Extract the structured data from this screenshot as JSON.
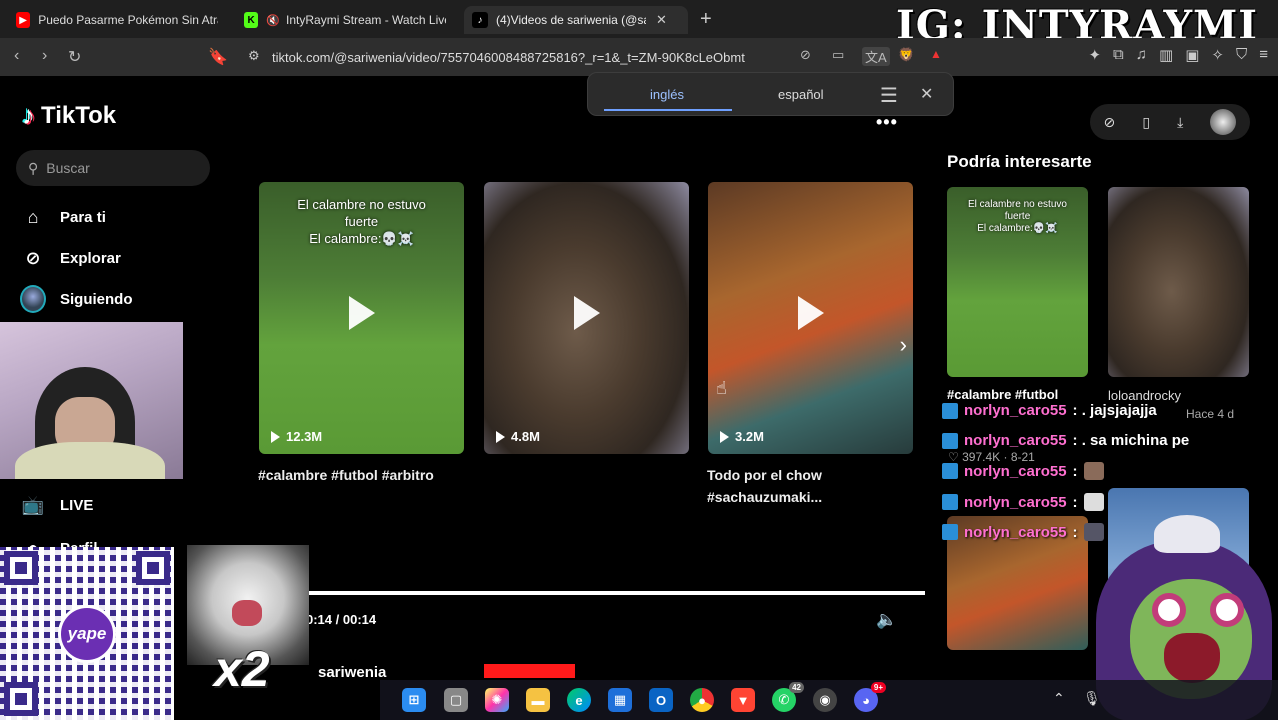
{
  "browser": {
    "tabs": [
      {
        "title": "Puedo Pasarme Pokémon Sin Atrapar",
        "icon": "youtube-icon"
      },
      {
        "title": "IntyRaymi Stream - Watch Live or",
        "icon": "kick-icon"
      },
      {
        "title": "(4)Videos de sariwenia (@sariwe",
        "icon": "tiktok-icon"
      }
    ],
    "url": "tiktok.com/@sariwenia/video/7557046008488725816?_r=1&_t=ZM-90K8cLeObmt",
    "overlay_text": "IG: INTYRAYMI"
  },
  "translate_popup": {
    "lang_from": "inglés",
    "lang_to": "español"
  },
  "tiktok": {
    "logo": "TikTok",
    "search_placeholder": "Buscar",
    "nav": {
      "for_you": "Para ti",
      "explore": "Explorar",
      "following": "Siguiendo",
      "live": "LIVE",
      "profile": "Perfil"
    },
    "videos": [
      {
        "caption_line1": "El calambre no estuvo",
        "caption_line2": "fuerte",
        "caption_line3": "El calambre:💀☠️",
        "views": "12.3M",
        "title": "#calambre #futbol #arbitro"
      },
      {
        "views": "4.8M"
      },
      {
        "views": "3.2M",
        "title_line1": "Todo por el chow",
        "title_line2": "#sachauzumaki..."
      }
    ],
    "more": "•••"
  },
  "suggestions": {
    "heading": "Podría interesarte",
    "item1": {
      "caption_line1": "El calambre no estuvo",
      "caption_line2": "fuerte",
      "caption_line3": "El calambre:💀☠️",
      "label": "#calambre #futbol"
    },
    "item2": {
      "label": "loloandrocky",
      "age": "Hace 4 d"
    },
    "likes": "397.4K",
    "date": "8-21"
  },
  "chat": [
    {
      "user": "norlyn_caro55",
      "msg": ": . jajsjajajja"
    },
    {
      "user": "norlyn_caro55",
      "msg": ": . sa michina pe"
    },
    {
      "user": "norlyn_caro55",
      "msg": ":"
    },
    {
      "user": "norlyn_caro55",
      "msg": ":"
    },
    {
      "user": "norlyn_caro55",
      "msg": ":"
    }
  ],
  "player": {
    "time": "0:14 / 00:14",
    "creator": "sariwenia",
    "progress": 1.0
  },
  "overlays": {
    "qr_brand": "yape",
    "multiplier": "x2"
  },
  "taskbar": {
    "whatsapp_count": "42",
    "discord_count": "9+"
  }
}
